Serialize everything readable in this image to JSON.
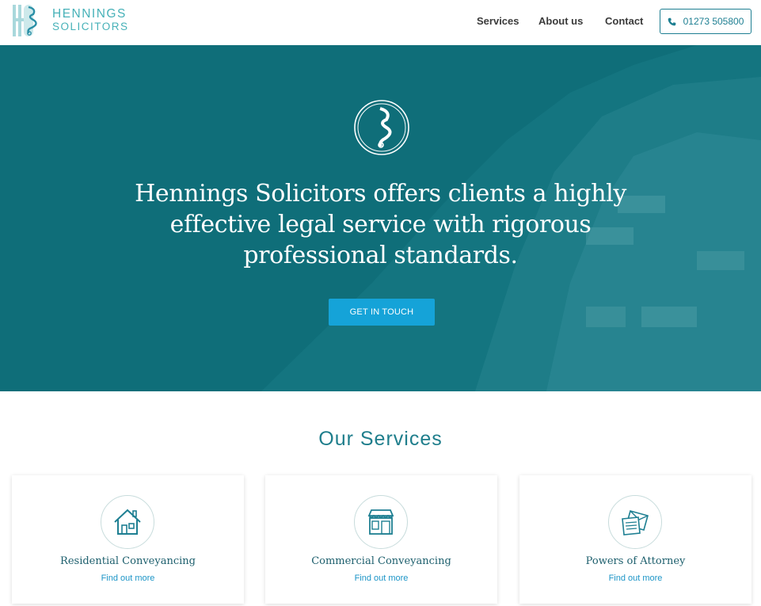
{
  "header": {
    "logo": {
      "line1": "HENNINGS",
      "line2": "SOLICITORS"
    },
    "nav": [
      {
        "label": "Services"
      },
      {
        "label": "About us"
      },
      {
        "label": "Contact"
      }
    ],
    "phone": {
      "number": "01273 505800",
      "icon": "phone-icon"
    }
  },
  "hero": {
    "emblem_icon": "seahorse-emblem-icon",
    "heading": "Hennings Solicitors offers clients a highly effective legal service with rigorous professional standards.",
    "cta_label": "GET IN TOUCH"
  },
  "services": {
    "title": "Our Services",
    "cards": [
      {
        "title": "Residential Conveyancing",
        "link": "Find out more",
        "icon": "house-icon"
      },
      {
        "title": "Commercial Conveyancing",
        "link": "Find out more",
        "icon": "shopfront-icon"
      },
      {
        "title": "Powers of Attorney",
        "link": "Find out more",
        "icon": "documents-icon"
      }
    ]
  },
  "colors": {
    "brand_teal": "#0f6e79",
    "accent_blue": "#15a3d8",
    "logo_teal": "#46b1b8",
    "heading_teal": "#1f7e8c"
  }
}
